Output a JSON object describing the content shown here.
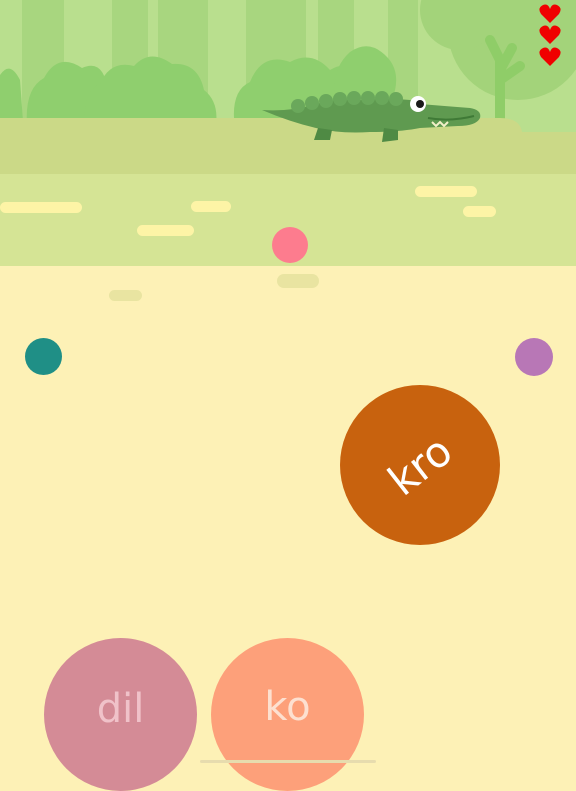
{
  "game": {
    "lives": 3,
    "syllables": {
      "floating": "kro",
      "choice_left": "dil",
      "choice_right": "ko"
    },
    "icons": {
      "life": "heart-icon",
      "creature": "crocodile-icon"
    },
    "colors": {
      "sky_jungle": "#b9df8e",
      "tree_dark": "#a6d47e",
      "bush": "#8fcf6e",
      "river": "#d5e495",
      "bank": "#cbd987",
      "sand": "#fdf1b6",
      "crocodile": "#5f9a50",
      "bubble_kro": "#c8620e",
      "bubble_dil": "#d48b96",
      "bubble_ko": "#fda07a",
      "dot_pink": "#fd7c8e",
      "dot_teal": "#1f8f86",
      "dot_purple": "#b877b6",
      "heart": "#f00000"
    }
  }
}
